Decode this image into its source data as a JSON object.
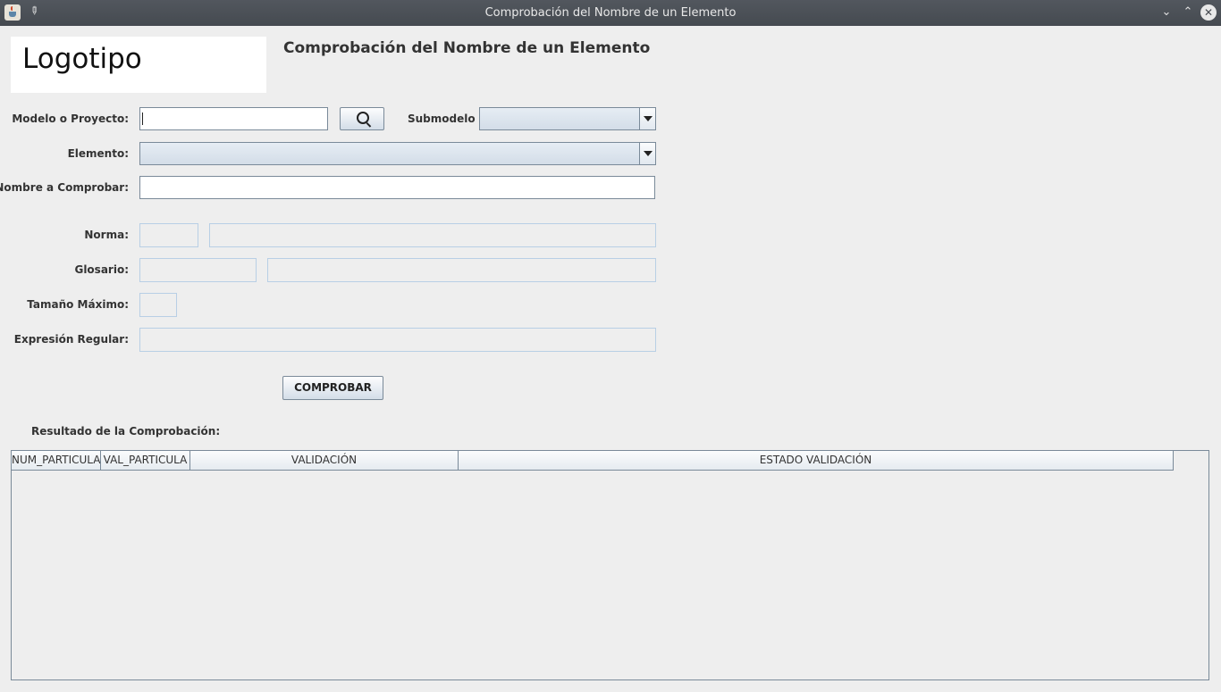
{
  "window": {
    "title": "Comprobación del Nombre de un Elemento"
  },
  "logo": {
    "text": "Logotipo"
  },
  "heading": "Comprobación del Nombre de un Elemento",
  "form": {
    "modelo_label": "Modelo o Proyecto:",
    "modelo_value": "",
    "submodelo_label": "Submodelo",
    "submodelo_value": "",
    "elemento_label": "Elemento:",
    "elemento_value": "",
    "nombre_label": "Nombre a Comprobar:",
    "nombre_value": "",
    "norma_label": "Norma:",
    "glosario_label": "Glosario:",
    "tamano_label": "Tamaño Máximo:",
    "expresion_label": "Expresión Regular:",
    "comprobar_button": "COMPROBAR"
  },
  "results": {
    "label": "Resultado de la Comprobación:",
    "columns": [
      "NUM_PARTICULA",
      "VAL_PARTICULA",
      "VALIDACIÓN",
      "ESTADO VALIDACIÓN"
    ],
    "rows": []
  }
}
